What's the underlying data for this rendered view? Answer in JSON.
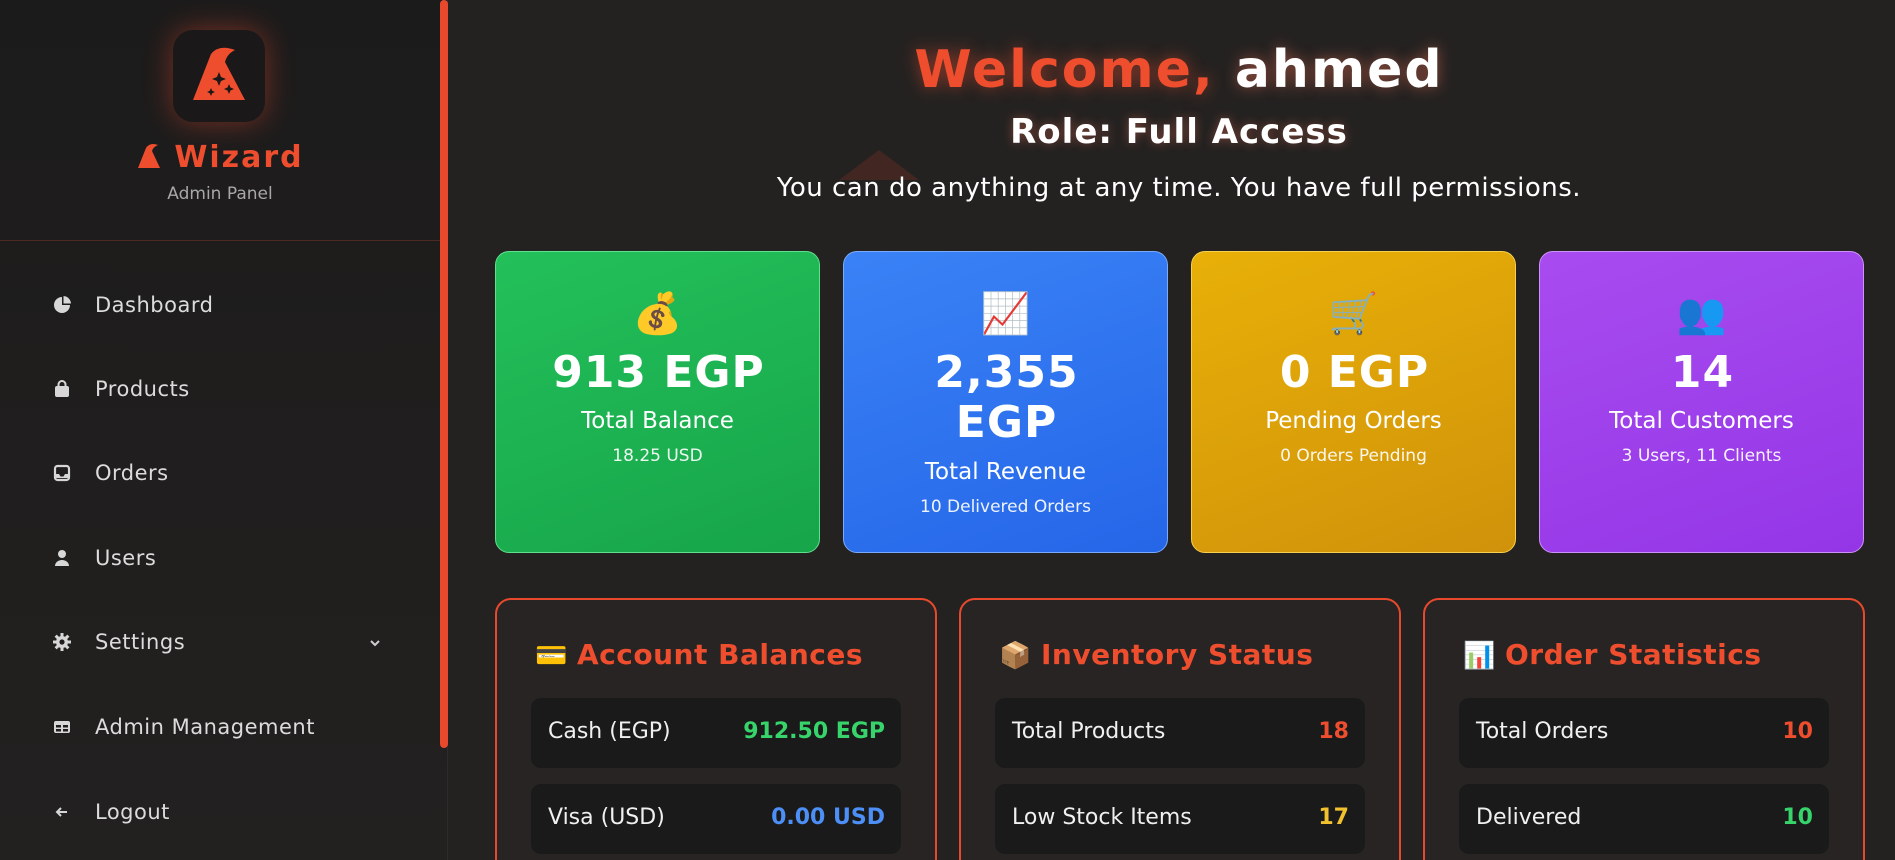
{
  "sidebar": {
    "brand": "Wizard",
    "subtitle": "Admin Panel",
    "items": [
      {
        "label": "Dashboard",
        "icon": "pie-chart-icon"
      },
      {
        "label": "Products",
        "icon": "shopping-bag-icon"
      },
      {
        "label": "Orders",
        "icon": "inbox-icon"
      },
      {
        "label": "Users",
        "icon": "user-icon"
      },
      {
        "label": "Settings",
        "icon": "gear-icon"
      },
      {
        "label": "Admin Management",
        "icon": "table-icon"
      },
      {
        "label": "Logout",
        "icon": "arrow-left-icon"
      }
    ]
  },
  "header": {
    "welcome_prefix": "Welcome,",
    "username": "ahmed",
    "role": "Role: Full Access",
    "permissions": "You can do anything at any time. You have full permissions."
  },
  "stats": [
    {
      "emoji": "💰",
      "value": "913 EGP",
      "label": "Total Balance",
      "sub": "18.25 USD",
      "color": "#1fb653"
    },
    {
      "emoji": "📈",
      "value_line1": "2,355",
      "value_line2": "EGP",
      "label": "Total Revenue",
      "sub": "10 Delivered Orders",
      "color": "#2f74ef"
    },
    {
      "emoji": "🛒",
      "value": "0 EGP",
      "label": "Pending Orders",
      "sub": "0 Orders Pending",
      "color": "#dca008"
    },
    {
      "emoji": "👥",
      "value": "14",
      "label": "Total Customers",
      "sub": "3 Users, 11 Clients",
      "color": "#9e41eb"
    }
  ],
  "panels": {
    "balances": {
      "icon": "💳",
      "title": "Account Balances",
      "rows": [
        {
          "label": "Cash (EGP)",
          "value": "912.50 EGP"
        },
        {
          "label": "Visa (USD)",
          "value": "0.00 USD"
        }
      ]
    },
    "inventory": {
      "icon": "📦",
      "title": "Inventory Status",
      "rows": [
        {
          "label": "Total Products",
          "value": "18"
        },
        {
          "label": "Low Stock Items",
          "value": "17"
        }
      ]
    },
    "orders": {
      "icon": "📊",
      "title": "Order Statistics",
      "rows": [
        {
          "label": "Total Orders",
          "value": "10"
        },
        {
          "label": "Delivered",
          "value": "10"
        }
      ]
    }
  },
  "colors": {
    "accent": "#e8492c",
    "background": "#242221"
  }
}
